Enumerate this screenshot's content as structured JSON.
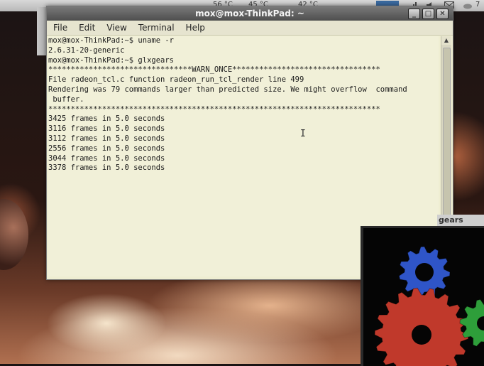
{
  "top_panel": {
    "indicators": [
      "56 °C",
      "45 °C",
      "42 °C"
    ],
    "tray_icons": [
      "cpu-monitor-icon",
      "network-signal-icon",
      "volume-icon",
      "mail-icon",
      "weather-icon"
    ],
    "tray_text": "7"
  },
  "terminal_window": {
    "title": "mox@mox-ThinkPad: ~",
    "window_buttons": {
      "minimize": "_",
      "maximize": "□",
      "close": "✕"
    },
    "menu": [
      "File",
      "Edit",
      "View",
      "Terminal",
      "Help"
    ],
    "lines": [
      "mox@mox-ThinkPad:~$ uname -r",
      "2.6.31-20-generic",
      "mox@mox-ThinkPad:~$ glxgears",
      "********************************WARN_ONCE*********************************",
      "File radeon_tcl.c function radeon_run_tcl_render line 499",
      "Rendering was 79 commands larger than predicted size. We might overflow  command",
      " buffer.",
      "**************************************************************************",
      "3425 frames in 5.0 seconds",
      "3116 frames in 5.0 seconds",
      "3112 frames in 5.0 seconds",
      "2556 frames in 5.0 seconds",
      "3044 frames in 5.0 seconds",
      "3378 frames in 5.0 seconds"
    ],
    "cursor_glyph": "I"
  },
  "gears_window": {
    "title": "gears",
    "colors": {
      "red": "#c0392b",
      "green": "#2e9e3a",
      "blue": "#2f55c8"
    }
  },
  "colors": {
    "terminal_bg": "#f1f0d8",
    "titlebar": "#5a5a5a"
  }
}
